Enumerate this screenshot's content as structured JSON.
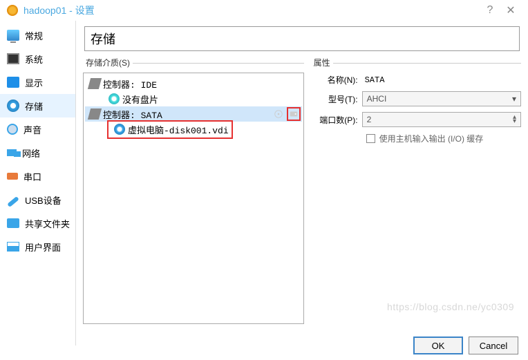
{
  "title": "hadoop01 - 设置",
  "sidebar": {
    "items": [
      {
        "label": "常规"
      },
      {
        "label": "系统"
      },
      {
        "label": "显示"
      },
      {
        "label": "存储"
      },
      {
        "label": "声音"
      },
      {
        "label": "网络"
      },
      {
        "label": "串口"
      },
      {
        "label": "USB设备"
      },
      {
        "label": "共享文件夹"
      },
      {
        "label": "用户界面"
      }
    ]
  },
  "header": {
    "title": "存储"
  },
  "storage": {
    "media_label": "存储介质(S)",
    "controllers": [
      {
        "label": "控制器: IDE",
        "children": [
          {
            "label": "没有盘片",
            "type": "cd"
          }
        ]
      },
      {
        "label": "控制器: SATA",
        "selected": true,
        "children": [
          {
            "label": "虚拟电脑-disk001.vdi",
            "type": "hdd",
            "highlighted": true
          }
        ]
      }
    ]
  },
  "props": {
    "group_label": "属性",
    "name_label": "名称(N):",
    "name_value": "SATA",
    "model_label": "型号(T):",
    "model_value": "AHCI",
    "ports_label": "端口数(P):",
    "ports_value": "2",
    "io_cache_label": "使用主机输入输出 (I/O) 缓存"
  },
  "buttons": {
    "ok": "OK",
    "cancel": "Cancel"
  },
  "watermark": "https://blog.csdn.ne/yc0309"
}
